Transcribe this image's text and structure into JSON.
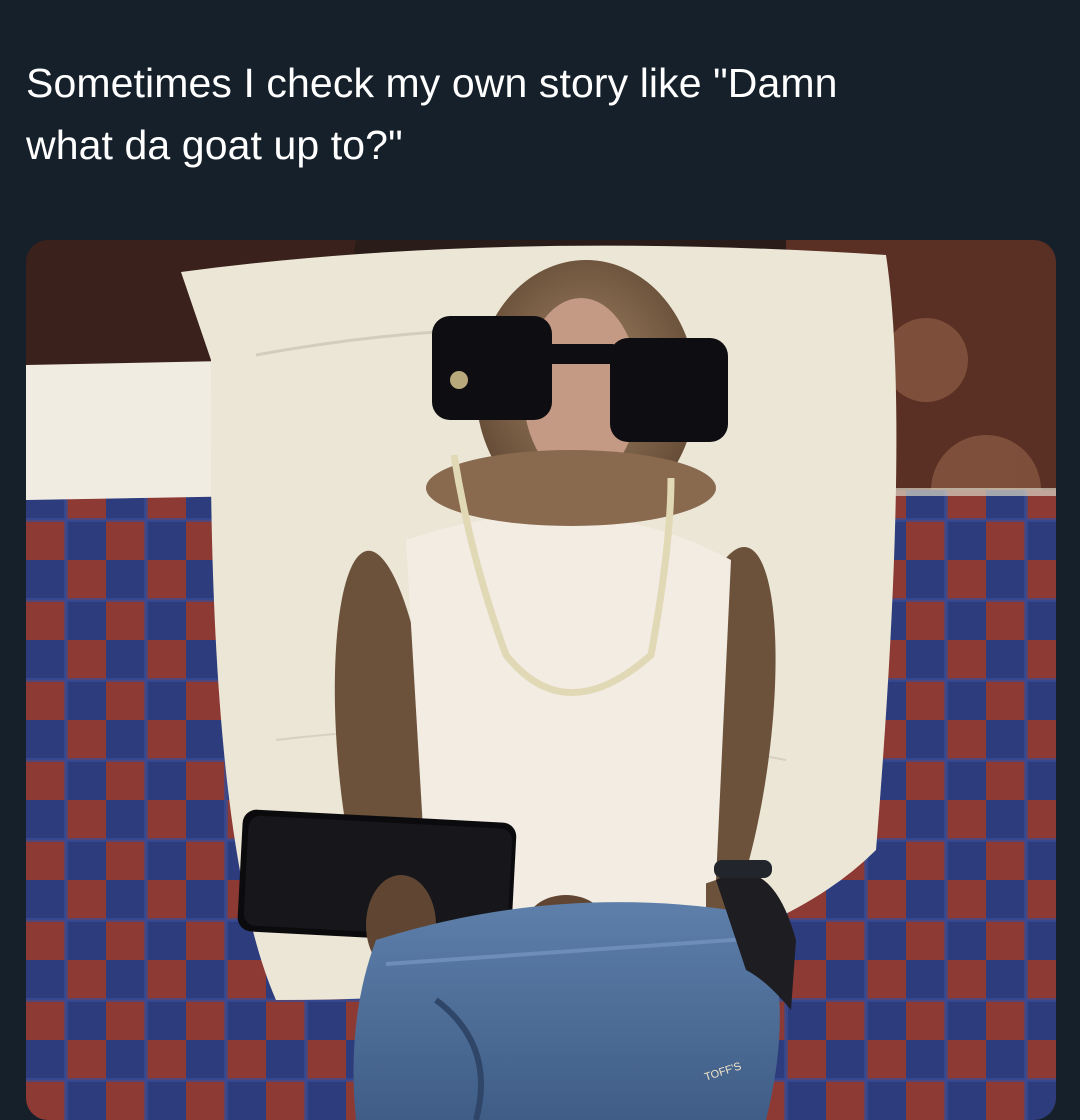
{
  "post": {
    "text": "Sometimes I check my own story like \"Damn\nwhat da goat up to?\"",
    "media": {
      "label_on_pants": "TOFF'S",
      "colors": {
        "background": "#15202b",
        "text": "#ffffff",
        "pillow": "#ece6d6",
        "blanket_red": "#8e3a34",
        "blanket_blue": "#2d3c7c",
        "monkey_fur": "#7d6245",
        "jeans": "#4f6f9b"
      },
      "icons": [
        "monkey-image",
        "sunglasses-icon",
        "gold-chain-icon",
        "smartphone-icon"
      ]
    }
  }
}
